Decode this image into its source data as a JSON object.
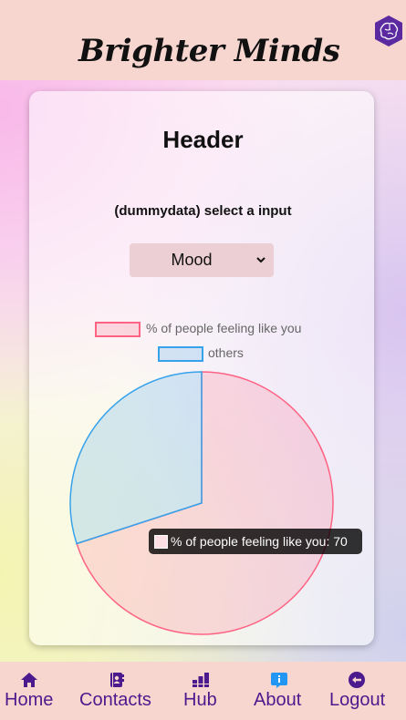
{
  "app": {
    "brand": "Brighter Minds"
  },
  "main": {
    "title": "Header",
    "subtitle": "(dummydata) select a input",
    "select": {
      "value": "Mood"
    }
  },
  "chart_data": {
    "type": "pie",
    "labels": [
      "% of people feeling like you",
      "others"
    ],
    "values": [
      70,
      30
    ],
    "colors": {
      "fill": [
        "rgba(255,99,132,0.2)",
        "rgba(54,162,235,0.2)"
      ],
      "border": [
        "#ff6384",
        "#36a2eb"
      ]
    },
    "legend": "top",
    "tooltip": "% of people feeling like you: 70"
  },
  "nav": {
    "items": [
      {
        "label": "Home",
        "icon": "home-icon"
      },
      {
        "label": "Contacts",
        "icon": "contacts-icon"
      },
      {
        "label": "Hub",
        "icon": "hub-icon"
      },
      {
        "label": "About",
        "icon": "about-icon"
      },
      {
        "label": "Logout",
        "icon": "logout-icon"
      }
    ],
    "color": "#4b1a8c"
  }
}
